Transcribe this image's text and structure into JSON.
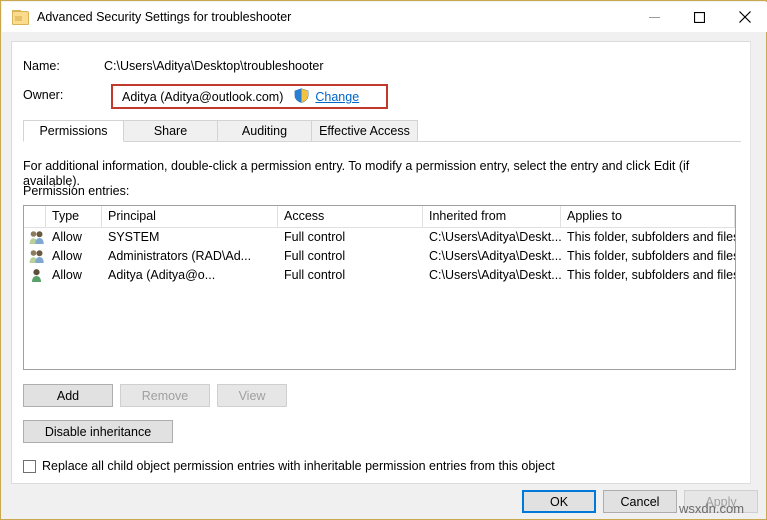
{
  "window": {
    "title": "Advanced Security Settings for troubleshooter",
    "icon": "folder-icon",
    "controls": {
      "minimize": "minimize-icon",
      "maximize": "maximize-icon",
      "close": "close-icon"
    }
  },
  "fields": {
    "name_label": "Name:",
    "name_value": "C:\\Users\\Aditya\\Desktop\\troubleshooter",
    "owner_label": "Owner:",
    "owner_value": "Aditya (Aditya@outlook.com)",
    "owner_shield_icon": "uac-shield-icon",
    "change_link": "Change"
  },
  "tabs": [
    {
      "label": "Permissions",
      "active": true
    },
    {
      "label": "Share",
      "active": false
    },
    {
      "label": "Auditing",
      "active": false
    },
    {
      "label": "Effective Access",
      "active": false
    }
  ],
  "info_text": "For additional information, double-click a permission entry. To modify a permission entry, select the entry and click Edit (if available).",
  "entries_label": "Permission entries:",
  "table": {
    "columns": [
      "Type",
      "Principal",
      "Access",
      "Inherited from",
      "Applies to"
    ],
    "rows": [
      {
        "icon": "group-icon",
        "type": "Allow",
        "principal": "SYSTEM",
        "access": "Full control",
        "inherited_from": "C:\\Users\\Aditya\\Deskt...",
        "applies_to": "This folder, subfolders and files"
      },
      {
        "icon": "group-icon",
        "type": "Allow",
        "principal": "Administrators (RAD\\Ad...",
        "access": "Full control",
        "inherited_from": "C:\\Users\\Aditya\\Deskt...",
        "applies_to": "This folder, subfolders and files"
      },
      {
        "icon": "user-icon",
        "type": "Allow",
        "principal": "Aditya (Aditya@o...",
        "access": "Full control",
        "inherited_from": "C:\\Users\\Aditya\\Deskt...",
        "applies_to": "This folder, subfolders and files"
      }
    ]
  },
  "buttons": {
    "add": "Add",
    "remove": "Remove",
    "view": "View",
    "disable_inheritance": "Disable inheritance"
  },
  "checkbox": {
    "label": "Replace all child object permission entries with inheritable permission entries from this object",
    "checked": false
  },
  "footer": {
    "ok": "OK",
    "cancel": "Cancel",
    "apply": "Apply"
  },
  "watermark": "wsxdn.com",
  "colors": {
    "window_border": "#c8a94e",
    "link": "#0066cc",
    "annotation": "#c0392b",
    "focus": "#0078d7"
  }
}
